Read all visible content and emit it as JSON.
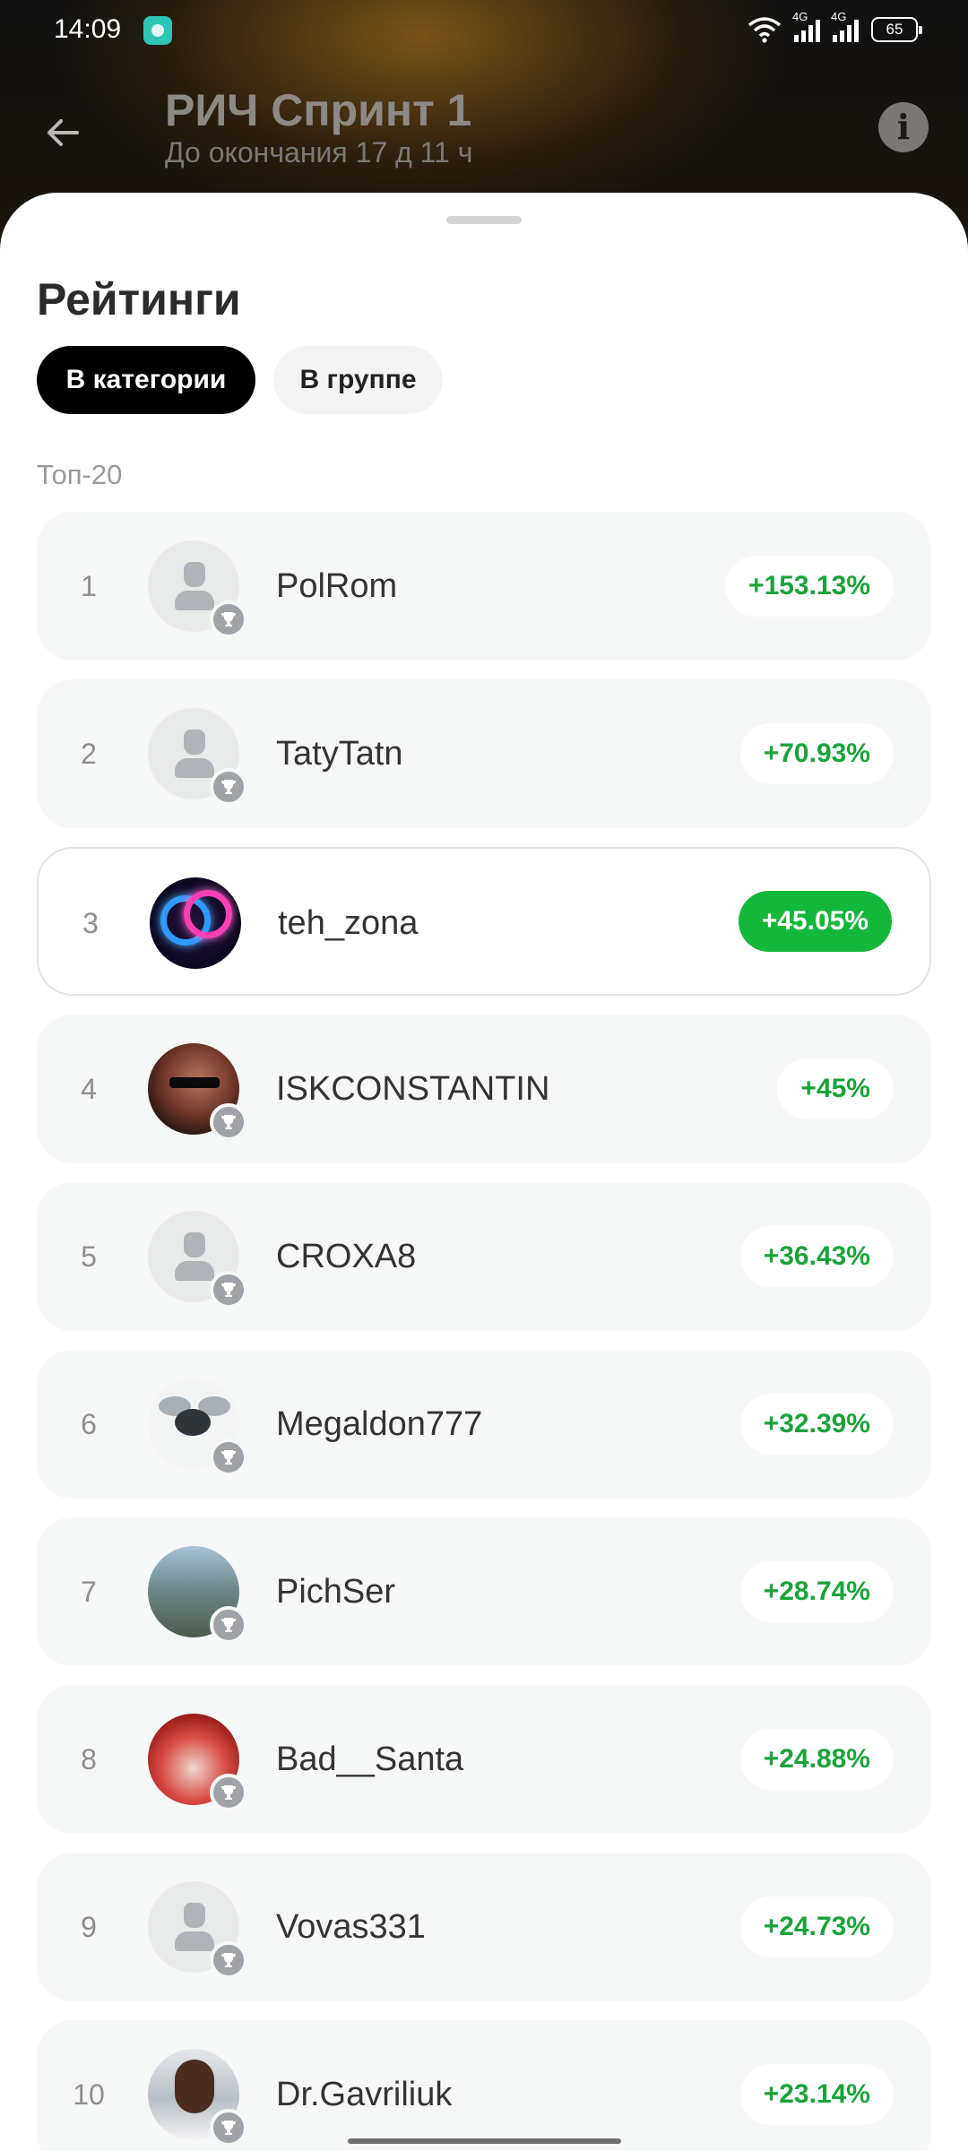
{
  "status_bar": {
    "time": "14:09",
    "network1": "4G",
    "network2": "4G",
    "battery": "65"
  },
  "header": {
    "title": "РИЧ Спринт 1",
    "subtitle": "До окончания 17 д 11 ч",
    "back_icon": "arrow-left-icon",
    "info_icon": "info-icon"
  },
  "sheet": {
    "heading": "Рейтинги",
    "tabs": [
      {
        "label": "В категории",
        "active": true
      },
      {
        "label": "В группе",
        "active": false
      }
    ],
    "section_label": "Топ-20"
  },
  "leaderboard": [
    {
      "rank": "1",
      "name": "PolRom",
      "percent": "+153.13%",
      "avatar": "placeholder"
    },
    {
      "rank": "2",
      "name": "TatyTatn",
      "percent": "+70.93%",
      "avatar": "placeholder"
    },
    {
      "rank": "3",
      "name": "teh_zona",
      "percent": "+45.05%",
      "avatar": "neon-rings",
      "current_user": true
    },
    {
      "rank": "4",
      "name": "ISKCONSTANTIN",
      "percent": "+45%",
      "avatar": "photo"
    },
    {
      "rank": "5",
      "name": "CROXA8",
      "percent": "+36.43%",
      "avatar": "placeholder"
    },
    {
      "rank": "6",
      "name": "Megaldon777",
      "percent": "+32.39%",
      "avatar": "fly"
    },
    {
      "rank": "7",
      "name": "PichSer",
      "percent": "+28.74%",
      "avatar": "gorillas"
    },
    {
      "rank": "8",
      "name": "Bad__Santa",
      "percent": "+24.88%",
      "avatar": "santa"
    },
    {
      "rank": "9",
      "name": "Vovas331",
      "percent": "+24.73%",
      "avatar": "placeholder"
    },
    {
      "rank": "10",
      "name": "Dr.Gavriliuk",
      "percent": "+23.14%",
      "avatar": "doctor"
    }
  ],
  "colors": {
    "positive_green": "#1aa33a",
    "highlight_badge": "#13b73a",
    "active_tab": "#000000"
  }
}
